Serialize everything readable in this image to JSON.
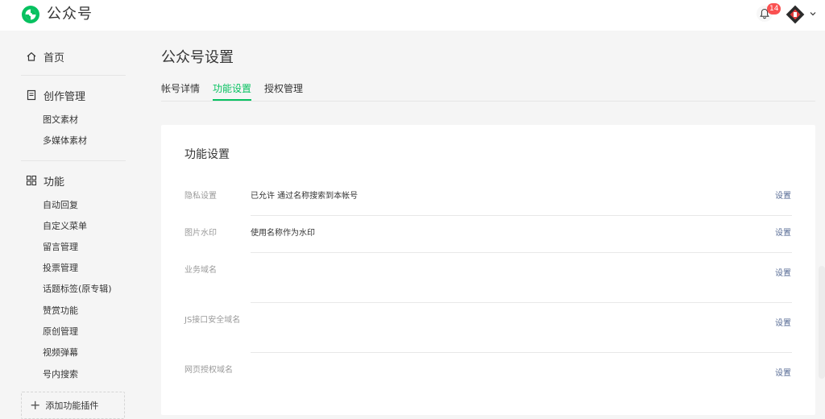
{
  "app": {
    "title": "公众号"
  },
  "header": {
    "notification_count": "14"
  },
  "sidebar": {
    "home": "首页",
    "creation": {
      "label": "创作管理",
      "items": [
        "图文素材",
        "多媒体素材"
      ]
    },
    "features": {
      "label": "功能",
      "items": [
        "自动回复",
        "自定义菜单",
        "留言管理",
        "投票管理",
        "话题标签(原专辑)",
        "赞赏功能",
        "原创管理",
        "视频弹幕",
        "号内搜索"
      ]
    },
    "add_plugin": "添加功能插件"
  },
  "main": {
    "title": "公众号设置",
    "tabs": [
      {
        "label": "帐号详情"
      },
      {
        "label": "功能设置"
      },
      {
        "label": "授权管理"
      }
    ],
    "card": {
      "title": "功能设置",
      "rows": [
        {
          "label": "隐私设置",
          "value": "已允许 通过名称搜索到本帐号",
          "action": "设置"
        },
        {
          "label": "图片水印",
          "value": "使用名称作为水印",
          "action": "设置"
        },
        {
          "label": "业务域名",
          "value": "",
          "action": "设置"
        },
        {
          "label": "JS接口安全域名",
          "value": "",
          "action": "设置"
        },
        {
          "label": "网页授权域名",
          "value": "",
          "action": "设置"
        }
      ]
    }
  },
  "colors": {
    "accent": "#07c160",
    "link": "#576b95",
    "badge": "#fa5151"
  },
  "icons": {
    "logo": "wechat-mp-logo-icon",
    "bell": "bell-icon",
    "home": "home-icon",
    "creation": "document-icon",
    "features": "grid-icon",
    "add": "plus-icon",
    "caret": "chevron-down-icon"
  }
}
